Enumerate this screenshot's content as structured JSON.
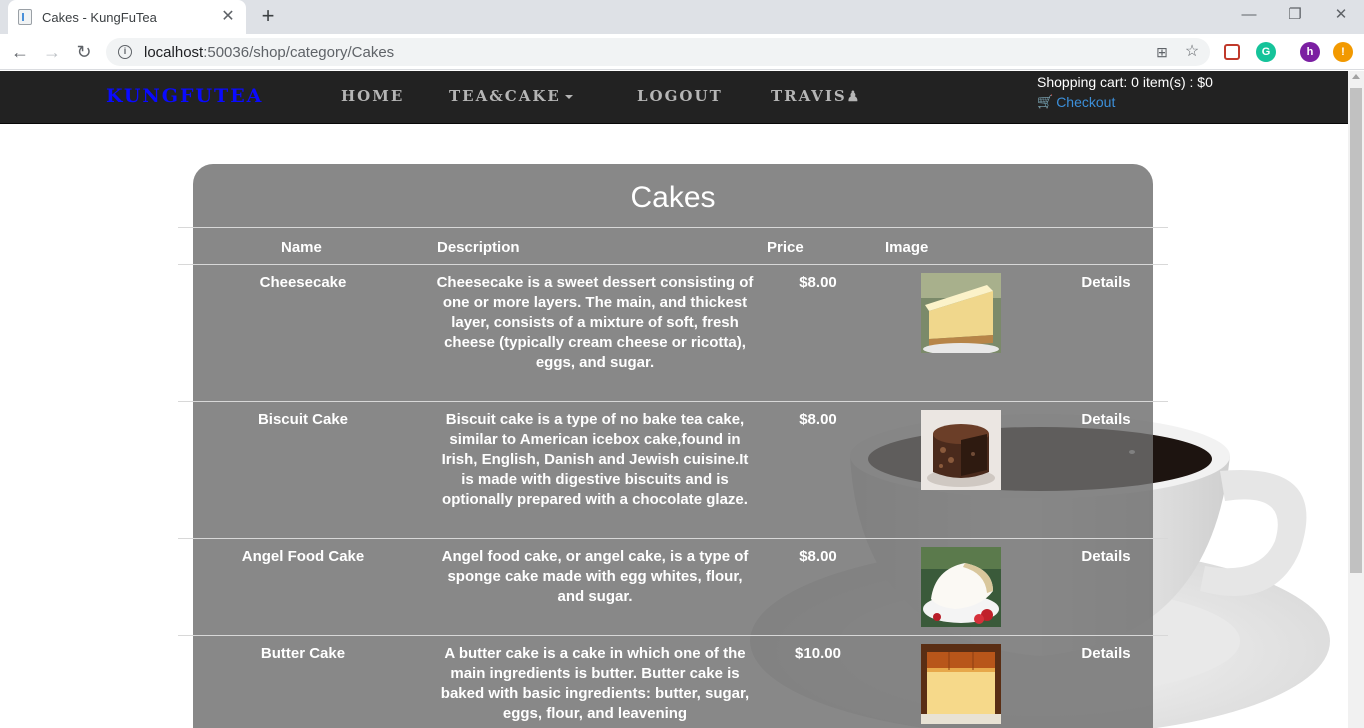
{
  "browser": {
    "tab_title": "Cakes - KungFuTea",
    "tab_close": "✕",
    "new_tab": "+",
    "url_host": "localhost",
    "url_path": ":50036/shop/category/Cakes"
  },
  "navbar": {
    "brand": "KUNGFUTEA",
    "links": [
      "HOME",
      "TEA&CAKE",
      "LOGOUT",
      "TRAVIS"
    ],
    "cart_summary": "Shopping cart: 0 item(s) : $0",
    "checkout": "Checkout"
  },
  "page": {
    "title": "Cakes",
    "columns": [
      "Name",
      "Description",
      "Price",
      "Image"
    ],
    "products": [
      {
        "name": "Cheesecake",
        "description": "Cheesecake is a sweet dessert consisting of one or more layers. The main, and thickest layer, consists of a mixture of soft, fresh cheese (typically cream cheese or ricotta), eggs, and sugar.",
        "price": "$8.00",
        "details": "Details"
      },
      {
        "name": "Biscuit Cake",
        "description": "Biscuit cake is a type of no bake tea cake, similar to American icebox cake,found in Irish, English, Danish and Jewish cuisine.It is made with digestive biscuits and is optionally prepared with a chocolate glaze.",
        "price": "$8.00",
        "details": "Details"
      },
      {
        "name": "Angel Food Cake",
        "description": "Angel food cake, or angel cake, is a type of sponge cake made with egg whites, flour, and sugar.",
        "price": "$8.00",
        "details": "Details"
      },
      {
        "name": "Butter Cake",
        "description": "A butter cake is a cake in which one of the main ingredients is butter. Butter cake is baked with basic ingredients: butter, sugar, eggs, flour, and leavening",
        "price": "$10.00",
        "details": "Details"
      }
    ]
  },
  "colors": {
    "brand": "#0a0aff",
    "link": "#3c8fd9",
    "navbar_bg": "#222222"
  }
}
